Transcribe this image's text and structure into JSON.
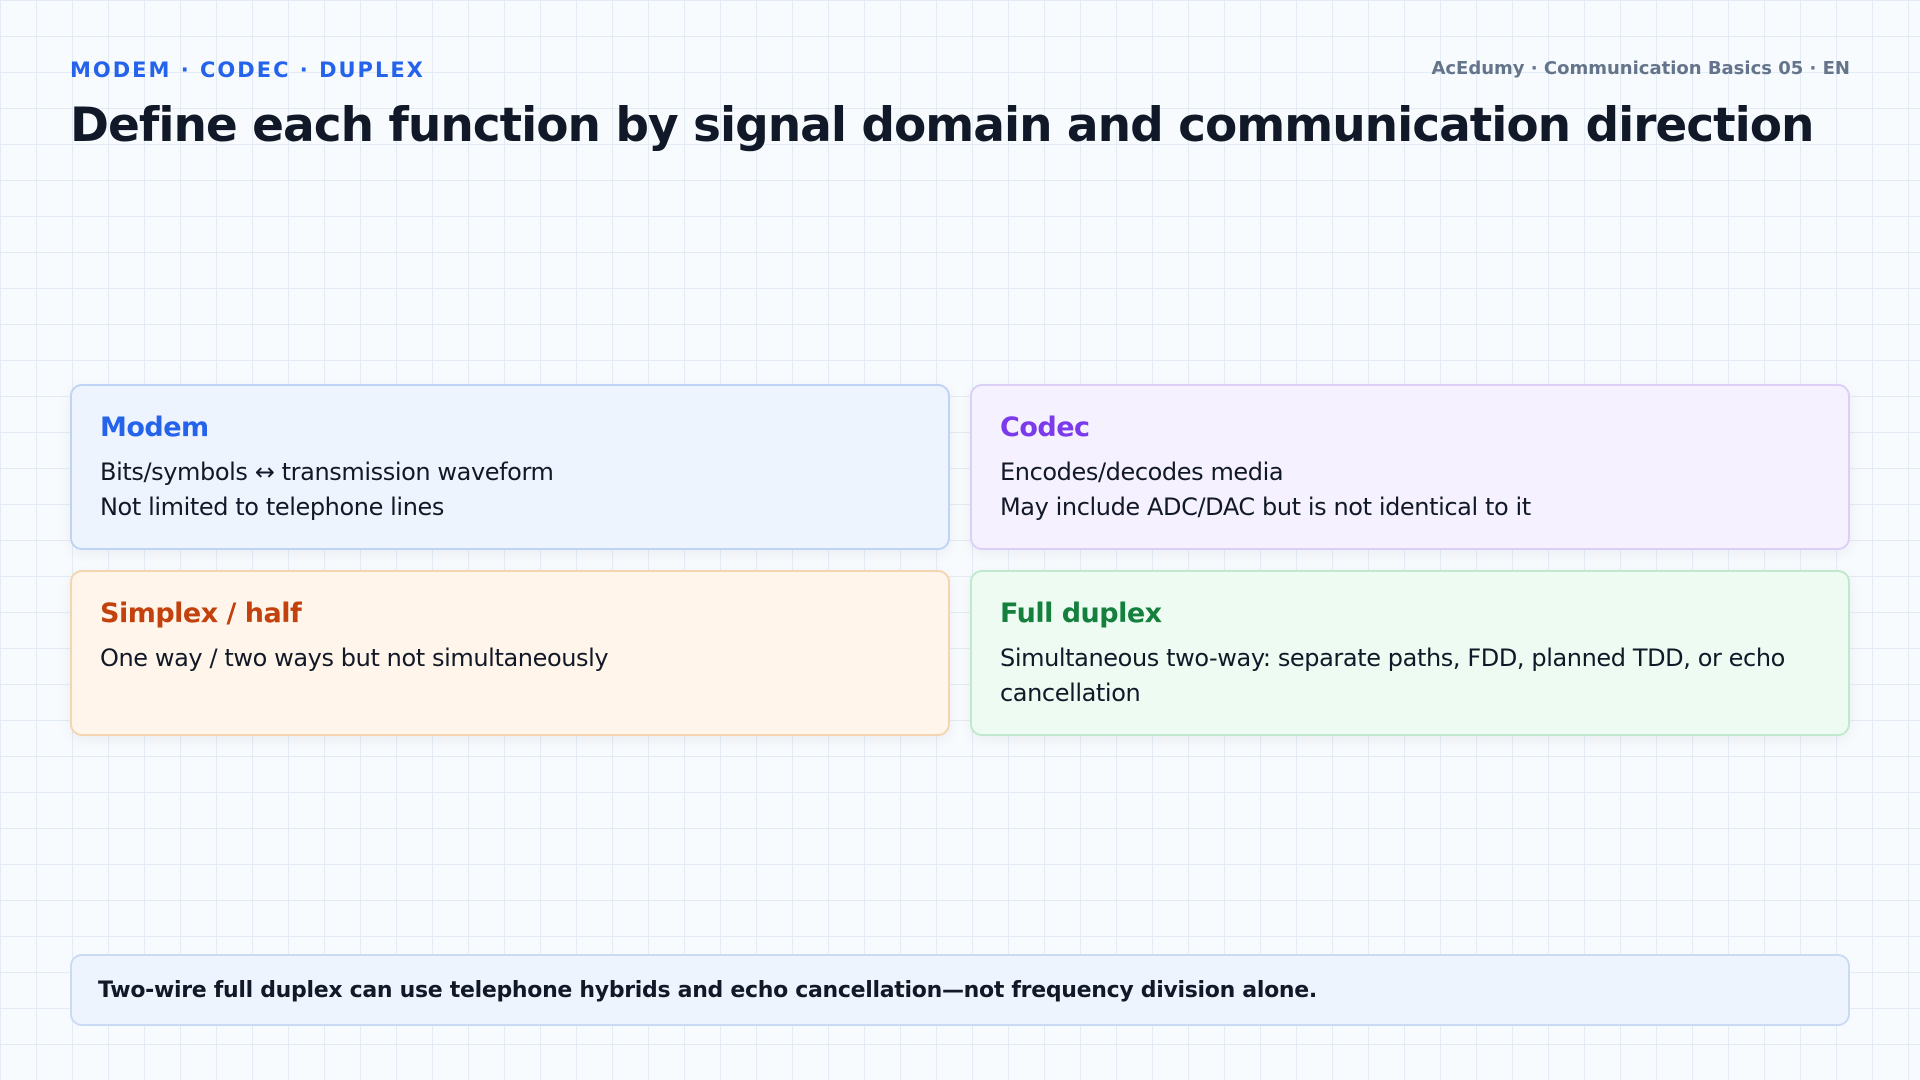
{
  "header": {
    "kicker": "MODEM · CODEC · DUPLEX",
    "meta": "AcEdumy · Communication Basics 05 · EN",
    "title": "Define each function by signal domain and communication direction"
  },
  "cards": [
    {
      "title": "Modem",
      "lines": [
        "Bits/symbols ↔ transmission waveform",
        "Not limited to telephone lines"
      ]
    },
    {
      "title": "Codec",
      "lines": [
        "Encodes/decodes media",
        "May include ADC/DAC but is not identical to it"
      ]
    },
    {
      "title": "Simplex / half",
      "lines": [
        "One way / two ways but not simultaneously"
      ]
    },
    {
      "title": "Full duplex",
      "lines": [
        "Simultaneous two-way: separate paths, FDD, planned TDD, or echo cancellation"
      ]
    }
  ],
  "footer_note": "Two-wire full duplex can use telephone hybrids and echo cancellation—not frequency division alone.",
  "colors": {
    "modem": "#2563eb",
    "codec": "#7c3aed",
    "simplex": "#c2410c",
    "full_duplex": "#15803d"
  }
}
